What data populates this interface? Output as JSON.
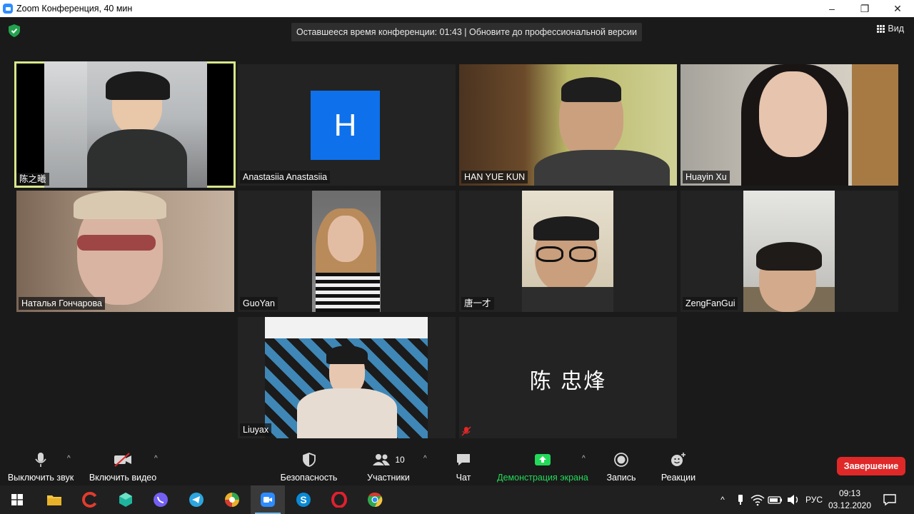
{
  "window": {
    "title": "Zoom Конференция, 40 мин",
    "controls": [
      "–",
      "❐",
      "✕"
    ]
  },
  "meeting": {
    "timer_text": "Оставшееся время конференции: 01:43 | Обновите до профессиональной версии",
    "view_label": "Вид"
  },
  "participants": [
    {
      "name": "陈之曦",
      "active": true
    },
    {
      "name": "Anastasiia Anastasiia",
      "avatar_letter": "H"
    },
    {
      "name": "HAN YUE KUN"
    },
    {
      "name": "Huayin Xu"
    },
    {
      "name": "Наталья Гончарова"
    },
    {
      "name": "GuoYan"
    },
    {
      "name": "唐一才"
    },
    {
      "name": "ZengFanGui"
    },
    {
      "name": "Liuyax"
    },
    {
      "name": "陈 忠烽",
      "muted": true
    }
  ],
  "toolbar": {
    "mute_label": "Выключить звук",
    "video_label": "Включить видео",
    "security_label": "Безопасность",
    "participants_label": "Участники",
    "participants_count": "10",
    "chat_label": "Чат",
    "share_label": "Демонстрация экрана",
    "record_label": "Запись",
    "reactions_label": "Реакции",
    "end_label": "Завершение",
    "share_color": "#23d959"
  },
  "taskbar": {
    "apps": [
      "windows-start",
      "file-explorer",
      "ccleaner",
      "cube-app",
      "viber",
      "telegram",
      "chrome-alt",
      "zoom",
      "skype",
      "opera",
      "chrome"
    ],
    "active_app": "zoom",
    "lang": "РУС",
    "time": "09:13",
    "date": "03.12.2020"
  },
  "colors": {
    "accent_active_speaker": "#d8e68a",
    "zoom_blue": "#0e71eb",
    "end_red": "#e02828"
  }
}
